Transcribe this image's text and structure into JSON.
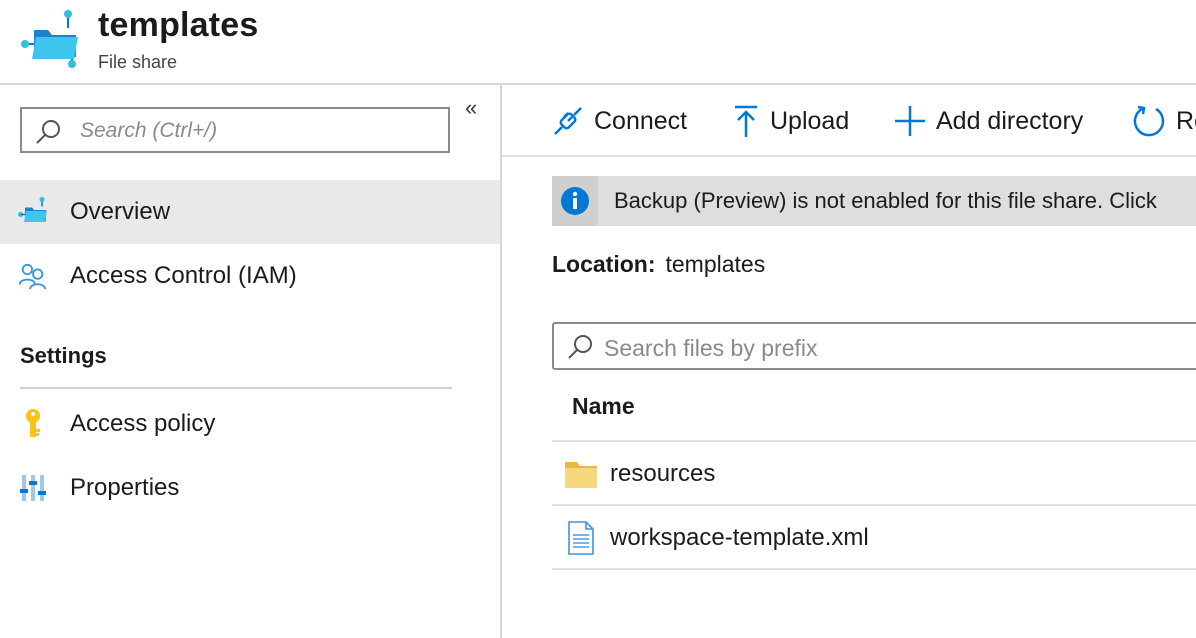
{
  "header": {
    "title": "templates",
    "subtitle": "File share",
    "icon": "file-share-icon"
  },
  "sidebar": {
    "collapse_glyph": "«",
    "search_placeholder": "Search (Ctrl+/)",
    "items": [
      {
        "label": "Overview",
        "icon": "file-share-icon",
        "active": true
      },
      {
        "label": "Access Control (IAM)",
        "icon": "people-icon",
        "active": false
      }
    ],
    "settings_title": "Settings",
    "settings_items": [
      {
        "label": "Access policy",
        "icon": "key-icon"
      },
      {
        "label": "Properties",
        "icon": "properties-icon"
      }
    ]
  },
  "toolbar": {
    "connect_label": "Connect",
    "upload_label": "Upload",
    "add_directory_label": "Add directory",
    "refresh_label": "Re"
  },
  "banner": {
    "text": "Backup (Preview) is not enabled for this file share. Click",
    "icon": "info-icon"
  },
  "location": {
    "label": "Location:",
    "value": "templates"
  },
  "files": {
    "search_placeholder": "Search files by prefix",
    "column_name": "Name",
    "rows": [
      {
        "name": "resources",
        "type": "folder"
      },
      {
        "name": "workspace-template.xml",
        "type": "file"
      }
    ]
  },
  "colors": {
    "accent": "#0078d4",
    "azure_cyan": "#32bedd",
    "active_bg": "#e9e9e9",
    "banner_bg": "#dedede",
    "folder": "#f5d77e",
    "key": "#f7c41a"
  }
}
